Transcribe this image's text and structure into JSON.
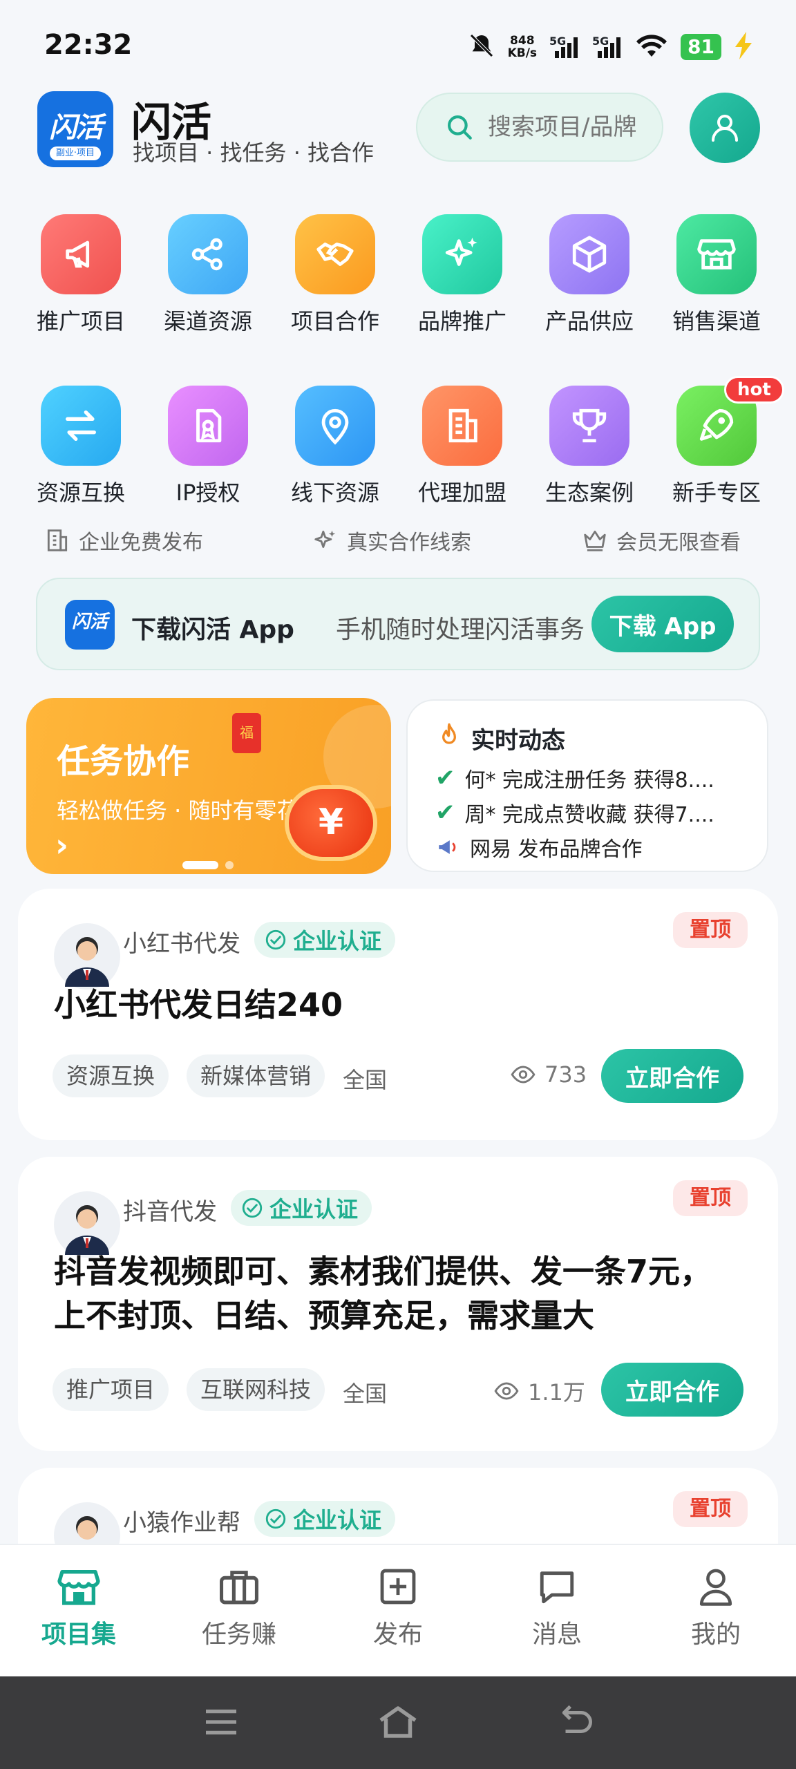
{
  "status_bar": {
    "time": "22:32",
    "speed_value": "848",
    "speed_unit": "KB/s",
    "signal1": "5G",
    "signal2": "5G",
    "battery": "81",
    "icons": [
      "mute-icon",
      "signal-icon",
      "wifi-icon",
      "battery-icon",
      "charging-icon"
    ]
  },
  "header": {
    "logo_text": "闪活",
    "logo_sub": "副业·项目",
    "app_name": "闪活",
    "tagline": "找项目 · 找任务 · 找合作",
    "search_placeholder": "搜索项目/品牌"
  },
  "categories_row1": [
    {
      "label": "推广项目",
      "color": "#f0524f",
      "icon": "megaphone-icon"
    },
    {
      "label": "渠道资源",
      "color": "#3fa7f5",
      "icon": "share-icon"
    },
    {
      "label": "项目合作",
      "color": "#fb9a1f",
      "icon": "handshake-icon"
    },
    {
      "label": "品牌推广",
      "color": "#21c9a0",
      "icon": "sparkle-icon"
    },
    {
      "label": "产品供应",
      "color": "#8e74f2",
      "icon": "box-icon"
    },
    {
      "label": "销售渠道",
      "color": "#25c17a",
      "icon": "store-icon"
    }
  ],
  "categories_row2": [
    {
      "label": "资源互换",
      "color": "#27a9f0",
      "icon": "swap-icon"
    },
    {
      "label": "IP授权",
      "color": "#c167ef",
      "icon": "license-icon"
    },
    {
      "label": "线下资源",
      "color": "#2d96f4",
      "icon": "location-icon"
    },
    {
      "label": "代理加盟",
      "color": "#fb6d3f",
      "icon": "building-icon"
    },
    {
      "label": "生态案例",
      "color": "#9a6cf0",
      "icon": "trophy-icon"
    },
    {
      "label": "新手专区",
      "color": "#52c83a",
      "icon": "rocket-icon",
      "badge": "hot"
    }
  ],
  "features": [
    {
      "label": "企业免费发布",
      "icon": "building-outline-icon"
    },
    {
      "label": "真实合作线索",
      "icon": "sparkle-outline-icon"
    },
    {
      "label": "会员无限查看",
      "icon": "crown-icon"
    }
  ],
  "download": {
    "logo_text": "闪活",
    "title": "下载闪活 App",
    "desc": "手机随时处理闪活事务",
    "button": "下载 App"
  },
  "promo": {
    "title": "任务协作",
    "subtitle": "轻松做任务 · 随时有零花",
    "arrow": "›",
    "coin": "¥",
    "envelope": "福"
  },
  "live": {
    "title": "实时动态",
    "items": [
      {
        "text": "何* 完成注册任务 获得8....",
        "icon": "check-icon"
      },
      {
        "text": "周* 完成点赞收藏 获得7....",
        "icon": "check-icon"
      },
      {
        "text": "网易 发布品牌合作",
        "icon": "megaphone-icon"
      }
    ]
  },
  "posts": [
    {
      "author": "小红书代发",
      "verify": "企业认证",
      "pin": "置顶",
      "title_lines": [
        "小红书代发日结240"
      ],
      "tags": [
        "资源互换",
        "新媒体营销"
      ],
      "region": "全国",
      "views": "733",
      "button": "立即合作"
    },
    {
      "author": "抖音代发",
      "verify": "企业认证",
      "pin": "置顶",
      "title_lines": [
        "抖音发视频即可、素材我们提供、发一条7元，",
        "上不封顶、日结、预算充足，需求量大"
      ],
      "tags": [
        "推广项目",
        "互联网科技"
      ],
      "region": "全国",
      "views": "1.1万",
      "button": "立即合作"
    },
    {
      "author": "小猿作业帮",
      "verify": "企业认证",
      "pin": "置顶"
    }
  ],
  "tabbar": [
    {
      "label": "项目集",
      "icon": "store-icon",
      "active": true
    },
    {
      "label": "任务赚",
      "icon": "briefcase-icon"
    },
    {
      "label": "发布",
      "icon": "plus-square-icon"
    },
    {
      "label": "消息",
      "icon": "message-icon"
    },
    {
      "label": "我的",
      "icon": "user-icon"
    }
  ],
  "colors": {
    "accent": "#16a88f",
    "pin_red": "#e8412f",
    "promo_orange": "#f9a025"
  }
}
